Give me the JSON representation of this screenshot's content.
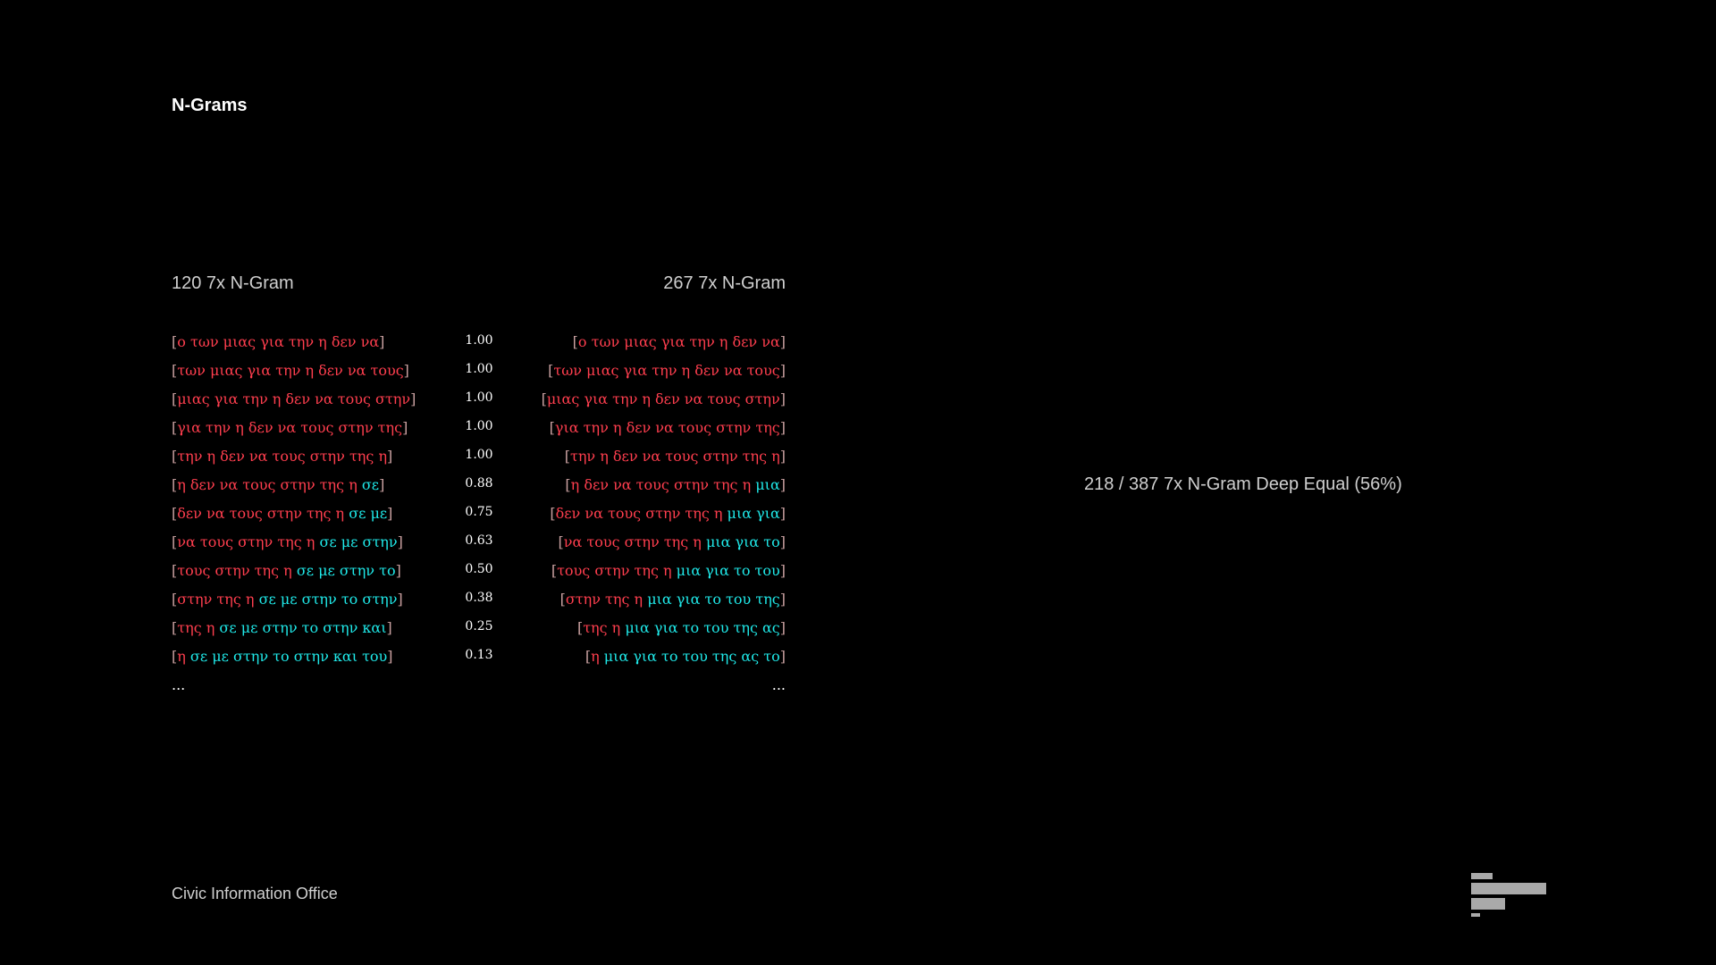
{
  "title": "N-Grams",
  "left_header": "120 7x N-Gram",
  "right_header": "267 7x N-Gram",
  "summary": "218 / 387 7x N-Gram Deep Equal (56%)",
  "footer": "Civic Information Office",
  "ellipsis": "...",
  "colors": {
    "background": "#000000",
    "mismatch": "#ff3e4e",
    "match": "#1fe8e8",
    "bracket": "#c9a0a0",
    "text": "#ffffff",
    "muted": "#cfcfcf",
    "logo": "#a9a9a9"
  },
  "rows": [
    {
      "score": "1.00",
      "left": [
        {
          "t": "ο των μιας για την η δεν να",
          "c": "red"
        }
      ],
      "right": [
        {
          "t": "ο των μιας για την η δεν να",
          "c": "red"
        }
      ]
    },
    {
      "score": "1.00",
      "left": [
        {
          "t": "των μιας για την η δεν να τους",
          "c": "red"
        }
      ],
      "right": [
        {
          "t": "των μιας για την η δεν να τους",
          "c": "red"
        }
      ]
    },
    {
      "score": "1.00",
      "left": [
        {
          "t": "μιας για την η δεν να τους στην",
          "c": "red"
        }
      ],
      "right": [
        {
          "t": "μιας για την η δεν να τους στην",
          "c": "red"
        }
      ]
    },
    {
      "score": "1.00",
      "left": [
        {
          "t": "για την η δεν να τους στην της",
          "c": "red"
        }
      ],
      "right": [
        {
          "t": "για την η δεν να τους στην της",
          "c": "red"
        }
      ]
    },
    {
      "score": "1.00",
      "left": [
        {
          "t": "την η δεν να τους στην της η",
          "c": "red"
        }
      ],
      "right": [
        {
          "t": "την η δεν να τους στην της η",
          "c": "red"
        }
      ]
    },
    {
      "score": "0.88",
      "left": [
        {
          "t": "η δεν να τους στην της η ",
          "c": "red"
        },
        {
          "t": "σε",
          "c": "cyan"
        }
      ],
      "right": [
        {
          "t": "η δεν να τους στην της η ",
          "c": "red"
        },
        {
          "t": "μια",
          "c": "cyan"
        }
      ]
    },
    {
      "score": "0.75",
      "left": [
        {
          "t": "δεν να τους στην της η ",
          "c": "red"
        },
        {
          "t": "σε με",
          "c": "cyan"
        }
      ],
      "right": [
        {
          "t": "δεν να τους στην της η ",
          "c": "red"
        },
        {
          "t": "μια για",
          "c": "cyan"
        }
      ]
    },
    {
      "score": "0.63",
      "left": [
        {
          "t": "να τους στην της η ",
          "c": "red"
        },
        {
          "t": "σε με στην",
          "c": "cyan"
        }
      ],
      "right": [
        {
          "t": "να τους στην της η ",
          "c": "red"
        },
        {
          "t": "μια για το",
          "c": "cyan"
        }
      ]
    },
    {
      "score": "0.50",
      "left": [
        {
          "t": "τους στην της η ",
          "c": "red"
        },
        {
          "t": "σε με στην το",
          "c": "cyan"
        }
      ],
      "right": [
        {
          "t": "τους στην της η ",
          "c": "red"
        },
        {
          "t": "μια για το του",
          "c": "cyan"
        }
      ]
    },
    {
      "score": "0.38",
      "left": [
        {
          "t": "στην της η ",
          "c": "red"
        },
        {
          "t": "σε με στην το στην",
          "c": "cyan"
        }
      ],
      "right": [
        {
          "t": "στην της η ",
          "c": "red"
        },
        {
          "t": "μια για το του της",
          "c": "cyan"
        }
      ]
    },
    {
      "score": "0.25",
      "left": [
        {
          "t": "της η ",
          "c": "red"
        },
        {
          "t": "σε με στην το στην και",
          "c": "cyan"
        }
      ],
      "right": [
        {
          "t": "της η ",
          "c": "red"
        },
        {
          "t": "μια για το του της ας",
          "c": "cyan"
        }
      ]
    },
    {
      "score": "0.13",
      "left": [
        {
          "t": "η ",
          "c": "red"
        },
        {
          "t": "σε με στην το στην και του",
          "c": "cyan"
        }
      ],
      "right": [
        {
          "t": "η ",
          "c": "red"
        },
        {
          "t": "μια για το του της ας το",
          "c": "cyan"
        }
      ]
    }
  ]
}
